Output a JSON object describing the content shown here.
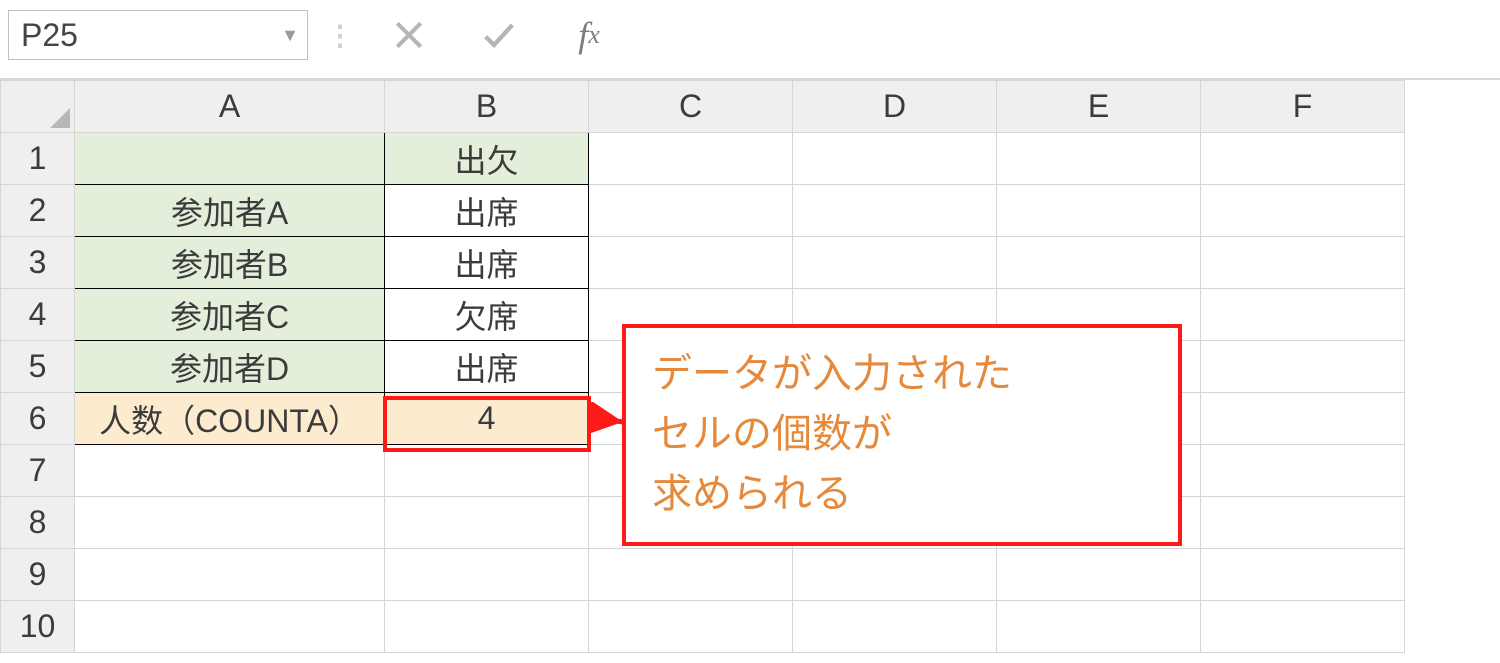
{
  "nameBox": "P25",
  "formulaBar": "",
  "columns": [
    "A",
    "B",
    "C",
    "D",
    "E",
    "F"
  ],
  "rows": [
    "1",
    "2",
    "3",
    "4",
    "5",
    "6",
    "7",
    "8",
    "9",
    "10"
  ],
  "cells": {
    "A1": "",
    "B1": "出欠",
    "A2": "参加者A",
    "B2": "出席",
    "A3": "参加者B",
    "B3": "出席",
    "A4": "参加者C",
    "B4": "欠席",
    "A5": "参加者D",
    "B5": "出席",
    "A6": "人数（COUNTA）",
    "B6": "4"
  },
  "callout": {
    "line1": "データが入力された",
    "line2": "セルの個数が",
    "line3": "求められる"
  }
}
